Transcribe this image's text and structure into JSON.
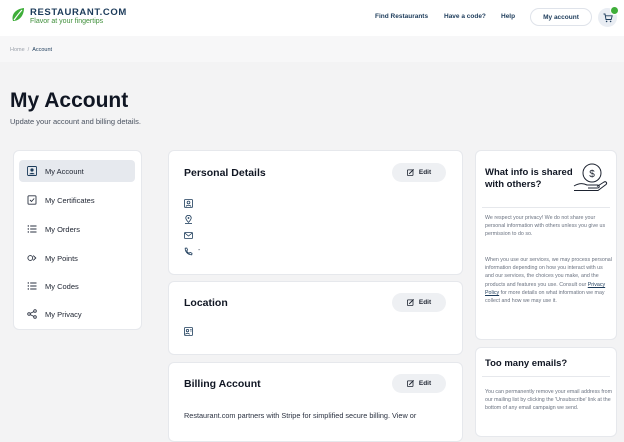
{
  "header": {
    "brand": "RESTAURANT.COM",
    "tagline": "Flavor at your fingertips",
    "nav": [
      "Find Restaurants",
      "Have a code?",
      "Help"
    ],
    "account_button": "My account",
    "accent_color": "#3fae3a",
    "brand_color": "#1c3b5a"
  },
  "breadcrumb": {
    "home": "Home",
    "separator": "/",
    "current": "Account"
  },
  "page": {
    "title": "My Account",
    "subtitle": "Update your account and billing details."
  },
  "sidebar": {
    "items": [
      {
        "label": "My Account",
        "icon": "account-icon",
        "active": true
      },
      {
        "label": "My Certificates",
        "icon": "certificate-icon",
        "active": false
      },
      {
        "label": "My Orders",
        "icon": "list-icon",
        "active": false
      },
      {
        "label": "My Points",
        "icon": "points-icon",
        "active": false
      },
      {
        "label": "My Codes",
        "icon": "list-icon",
        "active": false
      },
      {
        "label": "My Privacy",
        "icon": "share-icon",
        "active": false
      }
    ]
  },
  "personal_details": {
    "title": "Personal Details",
    "edit_label": "Edit",
    "rows": [
      "person-icon",
      "location-pin-icon",
      "mail-icon",
      "phone-icon"
    ],
    "phone_value": "-"
  },
  "location": {
    "title": "Location",
    "edit_label": "Edit"
  },
  "billing": {
    "title": "Billing Account",
    "edit_label": "Edit",
    "text": "Restaurant.com partners with Stripe for simplified secure billing. View or"
  },
  "info_shared": {
    "title_line1": "What info is shared",
    "title_line2": "with others?",
    "para1": "We respect your privacy! We do not share your personal information with others unless you give us permission to do so.",
    "para2_before": "When you use our services, we may process personal information depending on how you interact with us and our services, the choices you make, and the products and features you use. Consult our ",
    "privacy_link": "Privacy Policy",
    "para2_after": " for more details on what information we may collect and how we may use it."
  },
  "too_many_emails": {
    "title": "Too many emails?",
    "text": "You can permanently remove your email address from our mailing list by clicking the 'Unsubscribe' link at the bottom of any email campaign we send."
  }
}
